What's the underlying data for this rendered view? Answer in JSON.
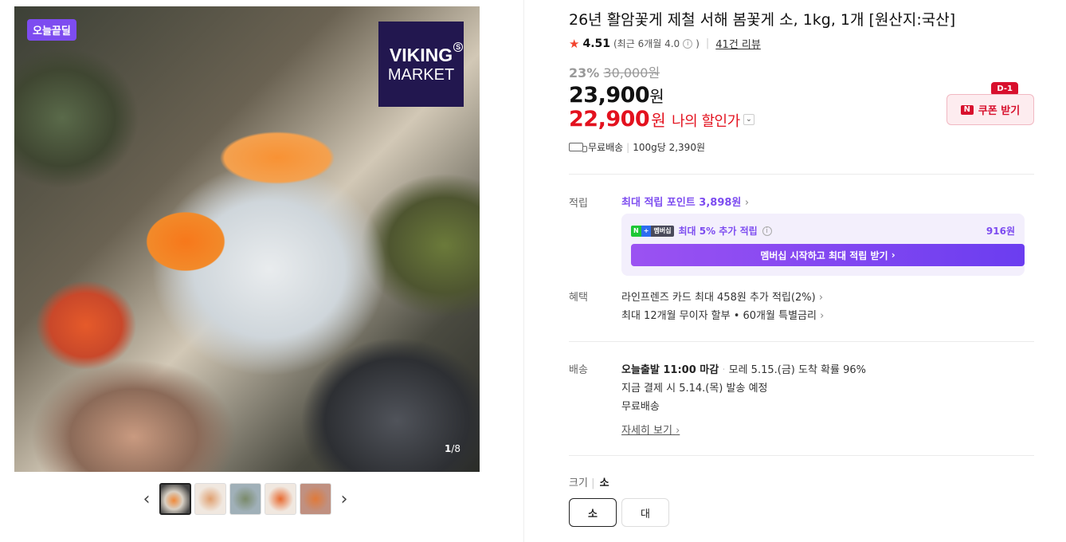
{
  "gallery": {
    "badge": "오늘끝딜",
    "logo_line1": "VIKING",
    "logo_mark": "S",
    "logo_line2": "MARKET",
    "counter_current": "1",
    "counter_total": "/8",
    "prev_icon": "‹",
    "next_icon": "›"
  },
  "product": {
    "title": "26년 활암꽃게 제철 서해 봄꽃게 소, 1kg, 1개 [원산지:국산]",
    "rating": "4.51",
    "rating_sub": "(최근 6개월 4.0",
    "rating_sub_end": ")",
    "review_count": "41건 리뷰",
    "discount_pct": "23%",
    "original_price": "30,000원",
    "price": "23,900",
    "price_unit": "원",
    "my_price": "22,900",
    "my_price_unit": "원",
    "my_discount_label": "나의 할인가",
    "shipping": "무료배송",
    "unit_price": "100g당 2,390원"
  },
  "coupon": {
    "tag": "D-1",
    "label": "쿠폰 받기",
    "icon": "N"
  },
  "points": {
    "label": "적립",
    "max_points": "최대 적립 포인트 3,898원",
    "member_badge_n": "N",
    "member_badge_plus": "+",
    "member_badge_text": "멤버십",
    "member_text": "최대 5% 추가 적립",
    "member_amount": "916원",
    "member_button": "멤버십 시작하고 최대 적립 받기"
  },
  "benefits": {
    "label": "혜택",
    "items": [
      "라인프렌즈 카드 최대 458원 추가 적립(2%)",
      "최대 12개월 무이자 할부 • 60개월 특별금리"
    ]
  },
  "delivery": {
    "label": "배송",
    "dispatch": "오늘출발 11:00 마감",
    "arrival": "모레 5.15.(금) 도착 확률 96%",
    "pay_note": "지금 결제 시 5.14.(목) 발송 예정",
    "fee": "무료배송",
    "detail_link": "자세히 보기"
  },
  "option": {
    "label": "크기",
    "selected": "소",
    "choices": [
      "소",
      "대"
    ]
  },
  "colors": {
    "accent_purple": "#7d4cf0",
    "price_red": "#e3111e",
    "coupon_red": "#d8102d"
  }
}
